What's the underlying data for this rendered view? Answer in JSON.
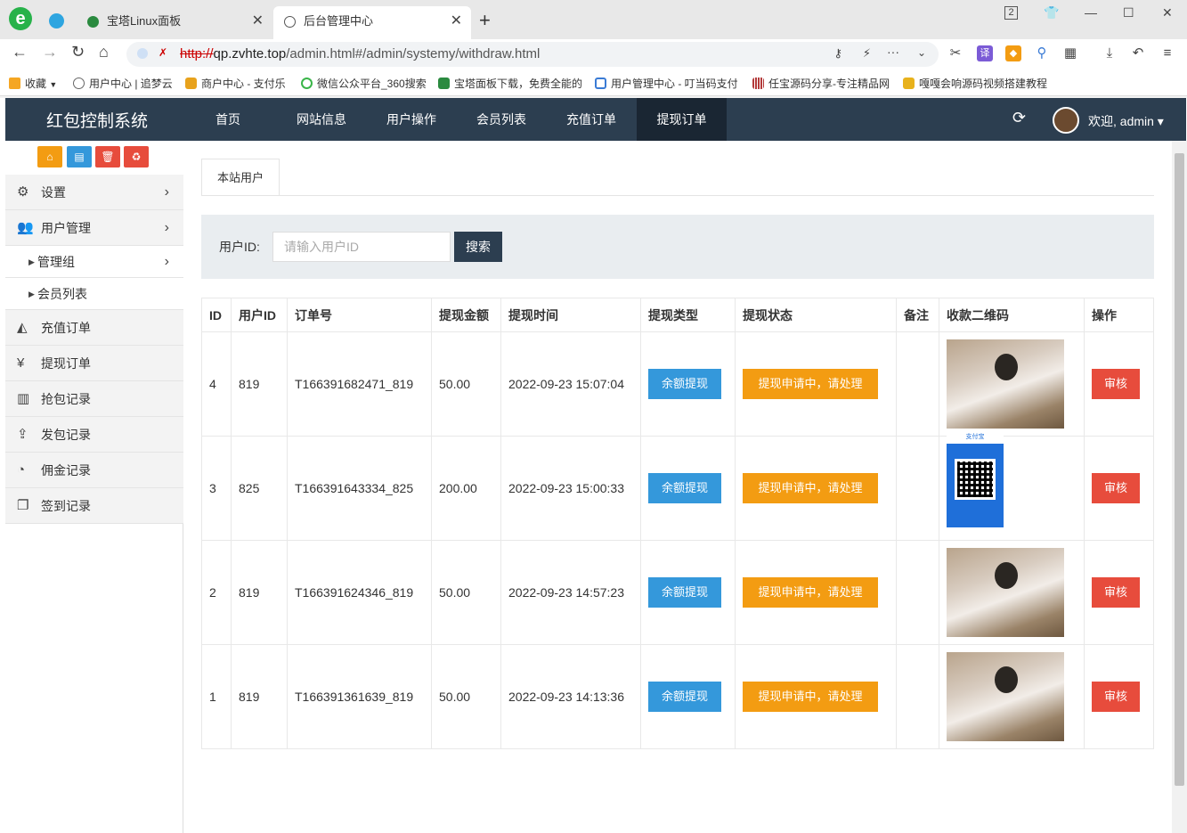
{
  "browser": {
    "logo": "e",
    "tabs": [
      {
        "title": "宝塔Linux面板"
      },
      {
        "title": "后台管理中心"
      }
    ],
    "window_badge": "2",
    "url": {
      "scheme": "http://",
      "host": "qp.zvhte.top",
      "path": "/admin.html#/admin/systemy/withdraw.html"
    },
    "bookmarks": [
      {
        "label": "收藏",
        "icon": "star-icon",
        "color": "#f5a623"
      },
      {
        "label": "用户中心 | 追梦云",
        "icon": "globe-icon",
        "color": "#666666"
      },
      {
        "label": "商户中心 - 支付乐",
        "icon": "merchant-icon",
        "color": "#e8a21c"
      },
      {
        "label": "微信公众平台_360搜索",
        "icon": "search-360-icon",
        "color": "#3ab549"
      },
      {
        "label": "宝塔面板下载，免费全能的",
        "icon": "bt-shield-icon",
        "color": "#2a8a3f"
      },
      {
        "label": "用户管理中心 - 叮当码支付",
        "icon": "shield-icon",
        "color": "#3a7bd5"
      },
      {
        "label": "任宝源码分享-专注精品网",
        "icon": "barcode-icon",
        "color": "#b33a3a"
      },
      {
        "label": "嘎嘎会响源码视频搭建教程",
        "icon": "crown-icon",
        "color": "#e8b21c"
      }
    ]
  },
  "header": {
    "brand": "红包控制系统",
    "nav": [
      {
        "label": "首页",
        "active": false
      },
      {
        "label": "网站信息",
        "active": false
      },
      {
        "label": "用户操作",
        "active": false
      },
      {
        "label": "会员列表",
        "active": false
      },
      {
        "label": "充值订单",
        "active": false
      },
      {
        "label": "提现订单",
        "active": true
      }
    ],
    "welcome": "欢迎, admin ▾"
  },
  "sidebar": {
    "quick_buttons": [
      {
        "name": "home-icon",
        "glyph": "⌂",
        "color": "#f39c12"
      },
      {
        "name": "document-icon",
        "glyph": "▤",
        "color": "#3498db"
      },
      {
        "name": "trash-icon",
        "glyph": "🗑",
        "color": "#e74c3c"
      },
      {
        "name": "recycle-icon",
        "glyph": "♻",
        "color": "#e74c3c"
      }
    ],
    "items": [
      {
        "label": "设置",
        "icon": "gears-icon",
        "glyph": "⚙",
        "chevron": true,
        "sub": false
      },
      {
        "label": "用户管理",
        "icon": "users-icon",
        "glyph": "👥",
        "chevron": true,
        "sub": false
      },
      {
        "label": "管理组",
        "icon": "",
        "glyph": "",
        "chevron": true,
        "sub": true
      },
      {
        "label": "会员列表",
        "icon": "",
        "glyph": "",
        "chevron": false,
        "sub": true
      },
      {
        "label": "充值订单",
        "icon": "area-chart-icon",
        "glyph": "◭",
        "chevron": false,
        "sub": false
      },
      {
        "label": "提现订单",
        "icon": "yen-icon",
        "glyph": "¥",
        "chevron": false,
        "sub": false
      },
      {
        "label": "抢包记录",
        "icon": "bar-chart-icon",
        "glyph": "▥",
        "chevron": false,
        "sub": false
      },
      {
        "label": "发包记录",
        "icon": "upload-icon",
        "glyph": "⇪",
        "chevron": false,
        "sub": false
      },
      {
        "label": "佣金记录",
        "icon": "pie-chart-icon",
        "glyph": "◔",
        "chevron": false,
        "sub": false
      },
      {
        "label": "签到记录",
        "icon": "window-restore-icon",
        "glyph": "❐",
        "chevron": false,
        "sub": false
      }
    ]
  },
  "page": {
    "tab": "本站用户",
    "search": {
      "label": "用户ID:",
      "placeholder": "请输入用户ID",
      "value": "",
      "button": "搜索"
    }
  },
  "table": {
    "columns": [
      "ID",
      "用户ID",
      "订单号",
      "提现金额",
      "提现时间",
      "提现类型",
      "提现状态",
      "备注",
      "收款二维码",
      "操作"
    ],
    "rows": [
      {
        "id": "4",
        "user_id": "819",
        "order_no": "T166391682471_819",
        "amount": "50.00",
        "time": "2022-09-23 15:07:04",
        "type": "余额提现",
        "status": "提现申请中，请处理",
        "note": "",
        "qr": "photo",
        "action": "审核"
      },
      {
        "id": "3",
        "user_id": "825",
        "order_no": "T166391643334_825",
        "amount": "200.00",
        "time": "2022-09-23 15:00:33",
        "type": "余额提现",
        "status": "提现申请中，请处理",
        "note": "",
        "qr": "alipay",
        "action": "审核"
      },
      {
        "id": "2",
        "user_id": "819",
        "order_no": "T166391624346_819",
        "amount": "50.00",
        "time": "2022-09-23 14:57:23",
        "type": "余额提现",
        "status": "提现申请中，请处理",
        "note": "",
        "qr": "photo",
        "action": "审核"
      },
      {
        "id": "1",
        "user_id": "819",
        "order_no": "T166391361639_819",
        "amount": "50.00",
        "time": "2022-09-23 14:13:36",
        "type": "余额提现",
        "status": "提现申请中，请处理",
        "note": "",
        "qr": "photo",
        "action": "审核"
      }
    ]
  },
  "colors": {
    "header_bg": "#2c3e50",
    "type_btn": "#3498db",
    "status_btn": "#f39c12",
    "audit_btn": "#e74c3c"
  }
}
